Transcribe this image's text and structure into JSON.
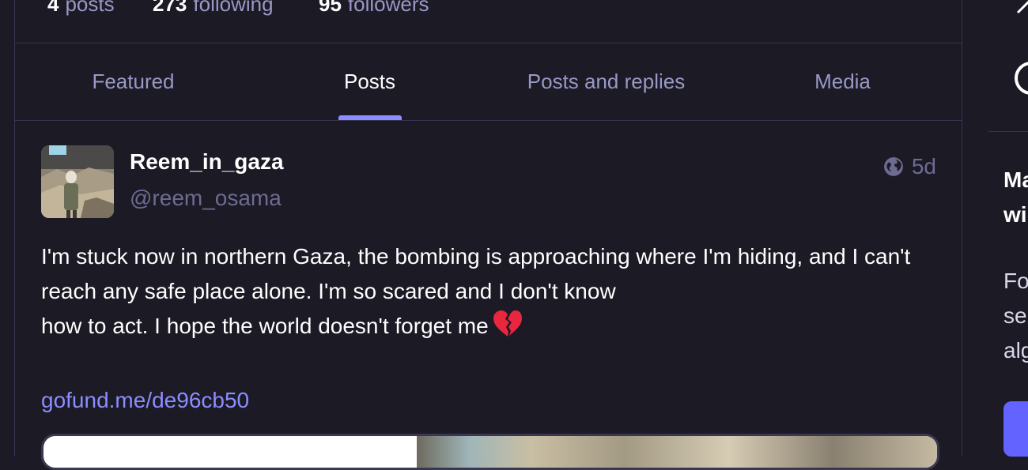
{
  "profile_stats": {
    "posts_count": "4",
    "posts_label": "posts",
    "following_count": "273",
    "following_label": "following",
    "followers_count": "95",
    "followers_label": "followers"
  },
  "tabs": [
    {
      "label": "Featured",
      "active": false
    },
    {
      "label": "Posts",
      "active": true
    },
    {
      "label": "Posts and replies",
      "active": false
    },
    {
      "label": "Media",
      "active": false
    }
  ],
  "post": {
    "display_name": "Reem_in_gaza",
    "handle": "@reem_osama",
    "visibility_icon": "globe-icon",
    "time": "5d",
    "body_line1": "I'm stuck now in northern Gaza, the bombing is approaching where I'm hiding, and I can't reach any safe place alone. I'm so scared and I don't know",
    "body_line2": "how to act. I hope the world doesn't forget me",
    "emoji_icon": "broken-heart-icon",
    "link_text": "gofund.me/de96cb50"
  },
  "sidebar": {
    "heading_line1": "Ma",
    "heading_line2": "wi",
    "text_line1": "Fo",
    "text_line2": "se",
    "text_line3": "alg"
  },
  "colors": {
    "background": "#1b1a25",
    "border": "#373552",
    "muted_text": "#9a98c6",
    "handle_text": "#6e6b93",
    "accent": "#8c8dff",
    "button": "#6364ff"
  }
}
